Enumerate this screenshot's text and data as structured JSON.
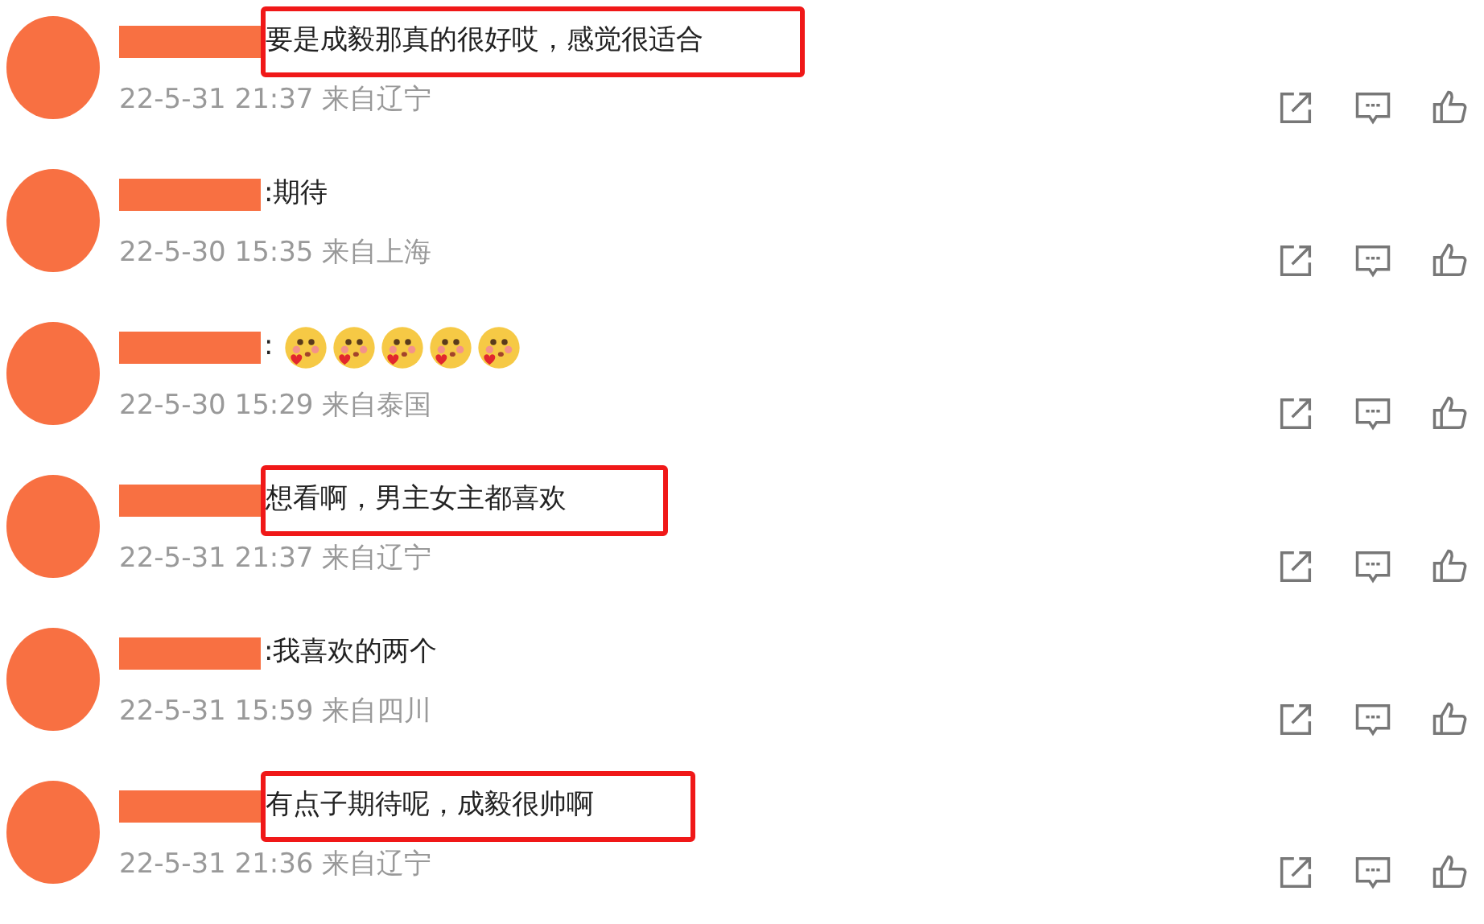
{
  "comments": [
    {
      "text": "要是成毅那真的很好哎，感觉很适合",
      "highlighted": true,
      "time": "22-5-31 21:37 来自辽宁"
    },
    {
      "text": ":期待",
      "highlighted": false,
      "time": "22-5-30 15:35 来自上海"
    },
    {
      "text": ":",
      "emojis": [
        {
          "kind": "heart-face"
        },
        {
          "kind": "heart-face"
        },
        {
          "kind": "heart-face"
        },
        {
          "kind": "heart-face"
        },
        {
          "kind": "heart-face"
        }
      ],
      "highlighted": false,
      "time": "22-5-30 15:29 来自泰国"
    },
    {
      "text": "想看啊，男主女主都喜欢",
      "highlighted": true,
      "time": "22-5-31 21:37 来自辽宁"
    },
    {
      "text": ":我喜欢的两个",
      "highlighted": false,
      "time": "22-5-31 15:59 来自四川"
    },
    {
      "text": "有点子期待呢，成毅很帅啊",
      "highlighted": true,
      "time": "22-5-31 21:36 来自辽宁"
    }
  ]
}
